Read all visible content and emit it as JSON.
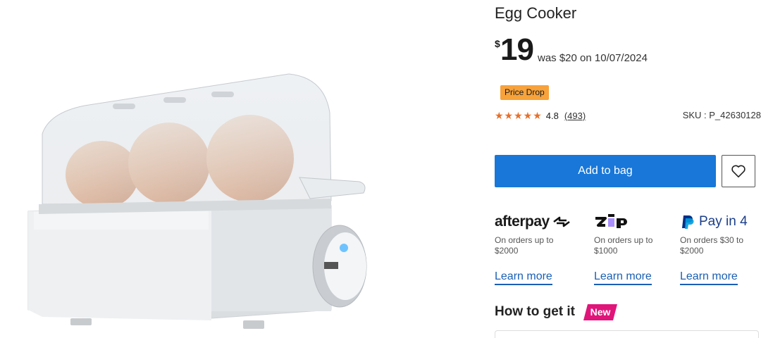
{
  "product": {
    "title": "Egg Cooker",
    "currency_symbol": "$",
    "price": "19",
    "was_text": "was $20 on 10/07/2024",
    "badge": "Price Drop",
    "rating_stars": "★★★★★",
    "rating_value": "4.8",
    "review_count": "(493)",
    "sku": "SKU : P_42630128",
    "image_icon": "egg-cooker-product-image"
  },
  "actions": {
    "add_to_bag": "Add to bag",
    "wishlist_icon": "heart-icon"
  },
  "payments": [
    {
      "name": "afterpay",
      "logo_text": "afterpay",
      "desc": "On orders up to $2000",
      "link": "Learn more"
    },
    {
      "name": "zip",
      "logo_text": "zip",
      "desc": "On orders up to $1000",
      "link": "Learn more"
    },
    {
      "name": "paypal",
      "logo_text": "Pay in 4",
      "desc": "On orders $30 to $2000",
      "link": "Learn more"
    }
  ],
  "delivery": {
    "title": "How to get it",
    "new_badge": "New"
  },
  "colors": {
    "primary_button": "#1877d8",
    "price_drop_badge": "#f7a23a",
    "stars": "#e7702a",
    "new_badge": "#e0157a",
    "zip_purple": "#aa8fff",
    "paypal_dark": "#003087",
    "paypal_light": "#009cde"
  }
}
